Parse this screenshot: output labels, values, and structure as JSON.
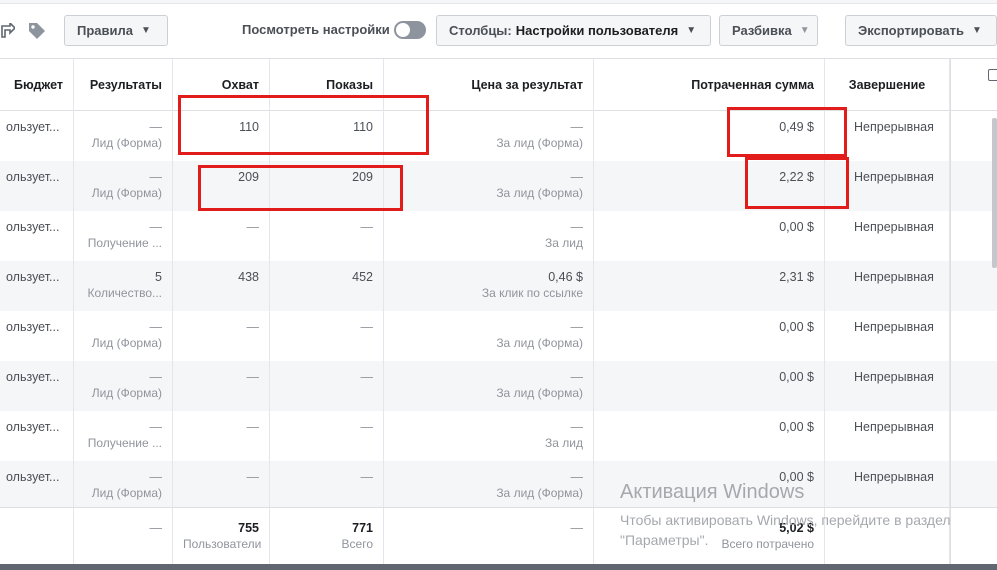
{
  "toolbar": {
    "rules_label": "Правила",
    "view_settings_label": "Посмотреть настройки",
    "columns_prefix": "Столбцы:",
    "columns_value": "Настройки пользователя",
    "breakdown_label": "Разбивка",
    "export_label": "Экспортировать"
  },
  "columns": [
    "Бюджет",
    "Результаты",
    "Охват",
    "Показы",
    "Цена за результат",
    "Потраченная сумма",
    "Завершение"
  ],
  "rows": [
    {
      "budget": "ользует...",
      "results": "—",
      "results_sub": "Лид (Форма)",
      "reach": "110",
      "impressions": "110",
      "cpr": "—",
      "cpr_sub": "За лид (Форма)",
      "spent": "0,49 $",
      "end": "Непрерывная"
    },
    {
      "budget": "ользует...",
      "results": "—",
      "results_sub": "Лид (Форма)",
      "reach": "209",
      "impressions": "209",
      "cpr": "—",
      "cpr_sub": "За лид (Форма)",
      "spent": "2,22 $",
      "end": "Непрерывная"
    },
    {
      "budget": "ользует...",
      "results": "—",
      "results_sub": "Получение ...",
      "reach": "—",
      "impressions": "—",
      "cpr": "—",
      "cpr_sub": "За лид",
      "spent": "0,00 $",
      "end": "Непрерывная"
    },
    {
      "budget": "ользует...",
      "results": "5",
      "results_sub": "Количество...",
      "reach": "438",
      "impressions": "452",
      "cpr": "0,46 $",
      "cpr_sub": "За клик по ссылке",
      "spent": "2,31 $",
      "end": "Непрерывная"
    },
    {
      "budget": "ользует...",
      "results": "—",
      "results_sub": "Лид (Форма)",
      "reach": "—",
      "impressions": "—",
      "cpr": "—",
      "cpr_sub": "За лид (Форма)",
      "spent": "0,00 $",
      "end": "Непрерывная"
    },
    {
      "budget": "ользует...",
      "results": "—",
      "results_sub": "Лид (Форма)",
      "reach": "—",
      "impressions": "—",
      "cpr": "—",
      "cpr_sub": "За лид (Форма)",
      "spent": "0,00 $",
      "end": "Непрерывная"
    },
    {
      "budget": "ользует...",
      "results": "—",
      "results_sub": "Получение ...",
      "reach": "—",
      "impressions": "—",
      "cpr": "—",
      "cpr_sub": "За лид",
      "spent": "0,00 $",
      "end": "Непрерывная"
    },
    {
      "budget": "ользует...",
      "results": "—",
      "results_sub": "Лид (Форма)",
      "reach": "—",
      "impressions": "—",
      "cpr": "—",
      "cpr_sub": "За лид (Форма)",
      "spent": "0,00 $",
      "end": "Непрерывная"
    }
  ],
  "totals": {
    "results": "—",
    "reach": "755",
    "reach_sub": "Пользователи",
    "impressions": "771",
    "impressions_sub": "Всего",
    "cpr": "—",
    "spent": "5,02 $",
    "spent_sub": "Всего потрачено"
  },
  "watermark": {
    "title": "Активация Windows",
    "subtitle": "Чтобы активировать Windows, перейдите в раздел \"Параметры\"."
  },
  "colors": {
    "highlight": "#e21b1b",
    "alt_row": "#f5f6f7",
    "border": "#dddfe2"
  },
  "icons": [
    "share-icon",
    "tag-icon",
    "caret-down-icon",
    "toggle-switch",
    "column-settings-icon"
  ]
}
